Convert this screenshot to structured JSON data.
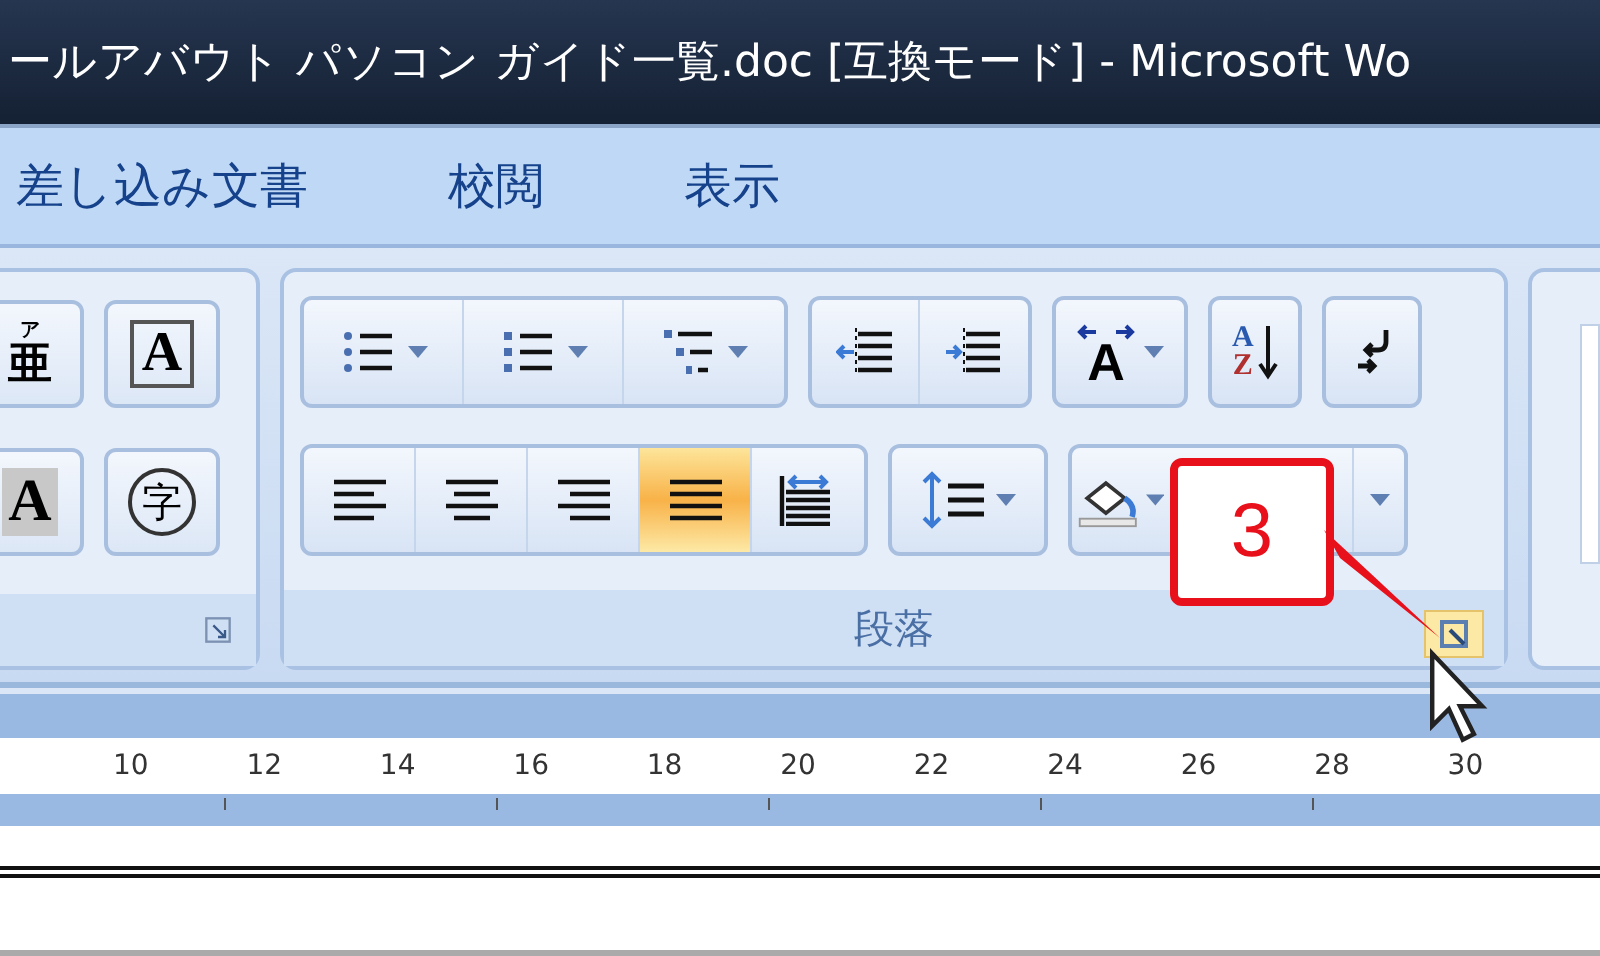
{
  "window": {
    "title": "ールアバウト パソコン ガイド一覧.doc [互換モード] - Microsoft Wo"
  },
  "tabs": [
    {
      "label": "差し込み文書",
      "selected": false
    },
    {
      "label": "校閲",
      "selected": false
    },
    {
      "label": "表示",
      "selected": false
    }
  ],
  "font_group": {
    "buttons": [
      {
        "kind": "phonetic",
        "glyph": "亜",
        "ruby": "ア"
      },
      {
        "kind": "bordered",
        "glyph": "A"
      },
      {
        "kind": "shaded",
        "glyph": "A"
      },
      {
        "kind": "enclosed",
        "glyph": "字"
      }
    ]
  },
  "paragraph": {
    "label": "段落",
    "launcher_hovered": true,
    "row1": [
      {
        "buttons": [
          {
            "kind": "bullets",
            "dropdown": true
          },
          {
            "kind": "numbering",
            "dropdown": true
          },
          {
            "kind": "multilevel",
            "dropdown": true
          }
        ]
      },
      {
        "buttons": [
          {
            "kind": "outdent",
            "dropdown": false
          },
          {
            "kind": "indent",
            "dropdown": false
          }
        ]
      },
      {
        "buttons": [
          {
            "kind": "asian",
            "dropdown": true,
            "glyph": "A"
          }
        ]
      },
      {
        "buttons": [
          {
            "kind": "sort",
            "dropdown": false,
            "glyph": "A",
            "glyph2": "Z"
          }
        ]
      },
      {
        "buttons": [
          {
            "kind": "marks",
            "dropdown": false
          }
        ]
      }
    ],
    "row2": [
      {
        "buttons": [
          {
            "kind": "left",
            "selected": false
          },
          {
            "kind": "center",
            "selected": false
          },
          {
            "kind": "right",
            "selected": false
          },
          {
            "kind": "justify",
            "selected": true
          },
          {
            "kind": "distributed",
            "selected": false
          }
        ]
      },
      {
        "buttons": [
          {
            "kind": "spacing",
            "dropdown": true
          }
        ]
      },
      {
        "buttons": [
          {
            "kind": "shading",
            "dropdown": true
          },
          {
            "kind": "hidden",
            "dropdown": true
          }
        ]
      }
    ]
  },
  "callout": {
    "label": "3"
  },
  "ruler": {
    "numbers": [
      "10",
      "12",
      "14",
      "16",
      "18",
      "20",
      "22",
      "24",
      "26",
      "28",
      "30"
    ]
  }
}
